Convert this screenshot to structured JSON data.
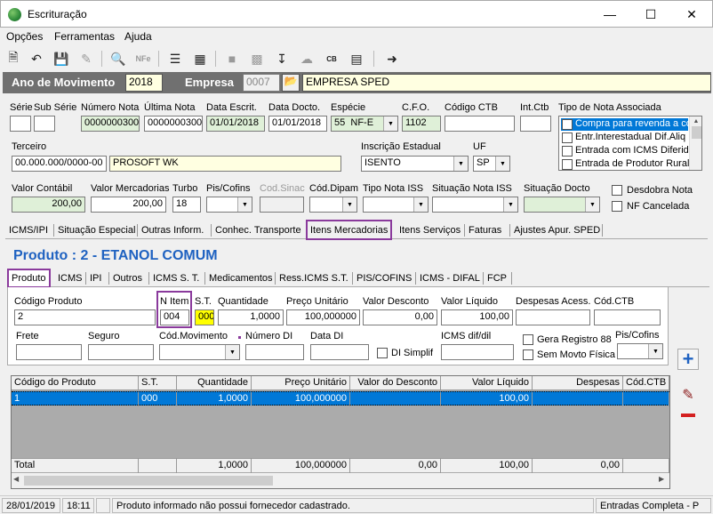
{
  "window": {
    "title": "Escrituração"
  },
  "menu": [
    "Opções",
    "Ferramentas",
    "Ajuda"
  ],
  "toolbar": {
    "icons": [
      "new-icon",
      "undo-icon",
      "save-icon",
      "brush-icon",
      "preview-icon",
      "nfe-icon",
      "tree-icon",
      "calc-icon",
      "folder-icon",
      "print-icon",
      "download-icon",
      "cloud-icon",
      "cb-icon",
      "list-icon",
      "exit-icon"
    ]
  },
  "year": {
    "label": "Ano de Movimento",
    "value": "2018",
    "empresa_label": "Empresa",
    "empresa_code": "0007",
    "empresa_name": "EMPRESA SPED"
  },
  "header": {
    "serie_label": "Série",
    "subserie_label": "Sub Série",
    "numnota_label": "Número Nota",
    "numnota": "0000000300",
    "ultnota_label": "Última Nota",
    "ultnota": "0000000300",
    "dataescr_label": "Data Escrit.",
    "dataescr": "01/01/2018",
    "datadocto_label": "Data Docto.",
    "datadocto": "01/01/2018",
    "especie_label": "Espécie",
    "especie_code": "55",
    "especie": "NF-E",
    "cfo_label": "C.F.O.",
    "cfo": "1102",
    "codctb_label": "Código CTB",
    "intctb_label": "Int.Ctb",
    "tiponota_label": "Tipo de Nota Associada",
    "tiponota_items": [
      "Compra para revenda a co",
      "Entr.Interestadual Dif.Aliq",
      "Entrada com ICMS Diferido",
      "Entrada de Produtor Rural"
    ],
    "terceiro_label": "Terceiro",
    "terceiro_cnpj": "00.000.000/0000-00",
    "terceiro_name": "PROSOFT WK",
    "inscr_label": "Inscrição Estadual",
    "inscr": "ISENTO",
    "uf_label": "UF",
    "uf": "SP",
    "valcontabil_label": "Valor Contábil",
    "valcontabil": "200,00",
    "valmerc_label": "Valor Mercadorias",
    "valmerc": "200,00",
    "turbo_label": "Turbo",
    "turbo": "18",
    "piscofins_label": "Pis/Cofins",
    "codsinac_label": "Cod.Sinac",
    "coddipam_label": "Cód.Dipam",
    "tiponotaiss_label": "Tipo Nota ISS",
    "situacaoiss_label": "Situação Nota ISS",
    "situacaodocto_label": "Situação Docto",
    "desdobra_label": "Desdobra Nota",
    "nfcancelada_label": "NF Cancelada"
  },
  "tabs": [
    "ICMS/IPI",
    "Situação Especial",
    "Outras Inform.",
    "Conhec. Transporte",
    "Itens Mercadorias",
    "Itens Serviços",
    "Faturas",
    "Ajustes Apur. SPED"
  ],
  "product": {
    "title": "Produto : 2 - ETANOL  COMUM",
    "subtabs": [
      "Produto",
      "ICMS",
      "IPI",
      "Outros",
      "ICMS S. T.",
      "Medicamentos",
      "Ress.ICMS S.T.",
      "PIS/COFINS",
      "ICMS - DIFAL",
      "FCP"
    ],
    "codprod_label": "Código Produto",
    "codprod": "2",
    "nitem_label": "N Item",
    "nitem": "004",
    "st_label": "S.T.",
    "st": "000",
    "qtd_label": "Quantidade",
    "qtd": "1,0000",
    "preco_label": "Preço Unitário",
    "preco": "100,000000",
    "desc_label": "Valor Desconto",
    "desc": "0,00",
    "liquido_label": "Valor Líquido",
    "liquido": "100,00",
    "despesas_label": "Despesas Acess.",
    "codctb_label": "Cód.CTB",
    "frete_label": "Frete",
    "seguro_label": "Seguro",
    "codmov_label": "Cód.Movimento",
    "numdi_label": "Número DI",
    "datadi_label": "Data DI",
    "disimplif_label": "DI Simplif",
    "icmsdif_label": "ICMS dif/dil",
    "gera_label": "Gera Registro 88",
    "semmovto_label": "Sem Movto Física",
    "piscofins_label": "Pis/Cofins"
  },
  "grid": {
    "columns": [
      "Código do Produto",
      "S.T.",
      "Quantidade",
      "Preço Unitário",
      "Valor do Desconto",
      "Valor Líquido",
      "Despesas",
      "Cód.CTB"
    ],
    "rows": [
      [
        "1",
        "000",
        "1,0000",
        "100,000000",
        "",
        "100,00",
        "",
        ""
      ]
    ],
    "total": [
      "Total",
      "",
      "1,0000",
      "100,000000",
      "0,00",
      "100,00",
      "0,00",
      ""
    ]
  },
  "status": {
    "date": "28/01/2019",
    "time": "18:11",
    "message": "Produto informado não possui fornecedor cadastrado.",
    "mode": "Entradas Completa - P"
  }
}
